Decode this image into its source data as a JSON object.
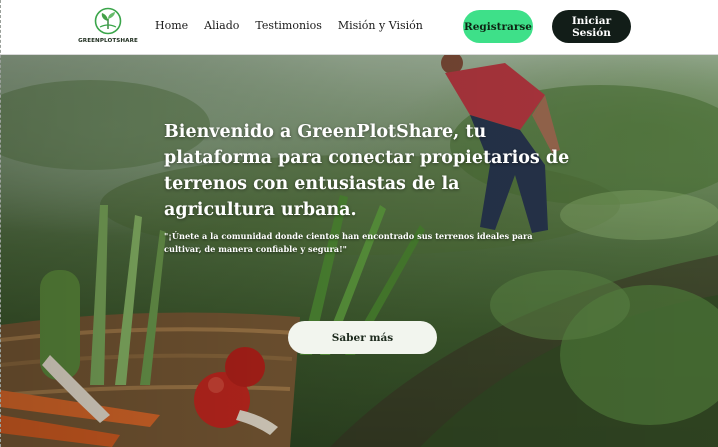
{
  "brand": {
    "name": "GREENPLOTSHARE",
    "logo_icon": "leaf-globe-icon"
  },
  "nav": {
    "items": [
      {
        "label": "Home"
      },
      {
        "label": "Aliado"
      },
      {
        "label": "Testimonios"
      },
      {
        "label": "Misión y Visión"
      }
    ],
    "register_label": "Registrarse",
    "login_label": "Iniciar Sesión"
  },
  "hero": {
    "title": "Bienvenido a GreenPlotShare, tu plataforma para conectar propietarios de terrenos con entusiastas de la agricultura urbana.",
    "quote": "\"¡Únete a la comunidad donde cientos han encontrado sus terrenos ideales para cultivar, de manera confiable y segura!\"",
    "cta_label": "Saber más"
  },
  "colors": {
    "register_bg": "#3ee089",
    "login_bg": "#121d18",
    "cta_bg": "#f2f5ee",
    "brand_green": "#3aa54a"
  }
}
